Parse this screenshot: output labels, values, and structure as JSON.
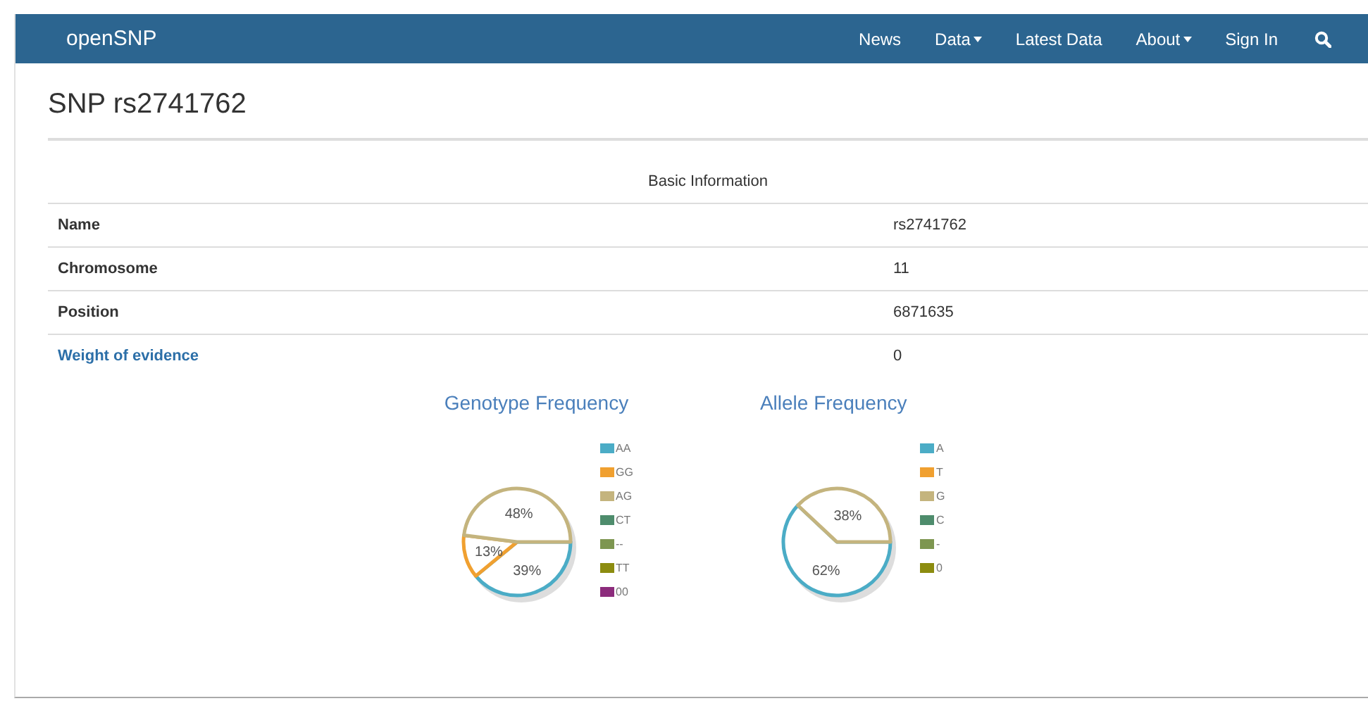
{
  "navbar": {
    "brand": "openSNP",
    "items": [
      {
        "label": "News",
        "dropdown": false
      },
      {
        "label": "Data",
        "dropdown": true
      },
      {
        "label": "Latest Data",
        "dropdown": false
      },
      {
        "label": "About",
        "dropdown": true
      },
      {
        "label": "Sign In",
        "dropdown": false
      }
    ]
  },
  "page_title": "SNP rs2741762",
  "table": {
    "caption": "Basic Information",
    "rows": [
      {
        "label": "Name",
        "value": "rs2741762",
        "link": false
      },
      {
        "label": "Chromosome",
        "value": "11",
        "link": false
      },
      {
        "label": "Position",
        "value": "6871635",
        "link": false
      },
      {
        "label": "Weight of evidence",
        "value": "0",
        "link": true
      }
    ]
  },
  "charts": [
    {
      "chart_data": {
        "type": "pie",
        "title": "Genotype Frequency",
        "categories": [
          "AA",
          "GG",
          "AG",
          "CT",
          "--",
          "TT",
          "00"
        ],
        "values": [
          39,
          13,
          48,
          0,
          0,
          0,
          0
        ],
        "colors": [
          "#4bacc6",
          "#f0a030",
          "#c4b47e",
          "#4e8c6c",
          "#7d9650",
          "#8c8c10",
          "#8c2c7c"
        ],
        "value_labels": [
          "39%",
          "13%",
          "48%",
          null,
          null,
          null,
          null
        ],
        "legend": "right"
      }
    },
    {
      "chart_data": {
        "type": "pie",
        "title": "Allele Frequency",
        "categories": [
          "A",
          "T",
          "G",
          "C",
          "-",
          "0"
        ],
        "values": [
          62,
          0,
          38,
          0,
          0,
          0
        ],
        "colors": [
          "#4bacc6",
          "#f0a030",
          "#c4b47e",
          "#4e8c6c",
          "#7d9650",
          "#8c8c10"
        ],
        "value_labels": [
          "62%",
          null,
          "38%",
          null,
          null,
          null
        ],
        "legend": "right"
      }
    }
  ]
}
